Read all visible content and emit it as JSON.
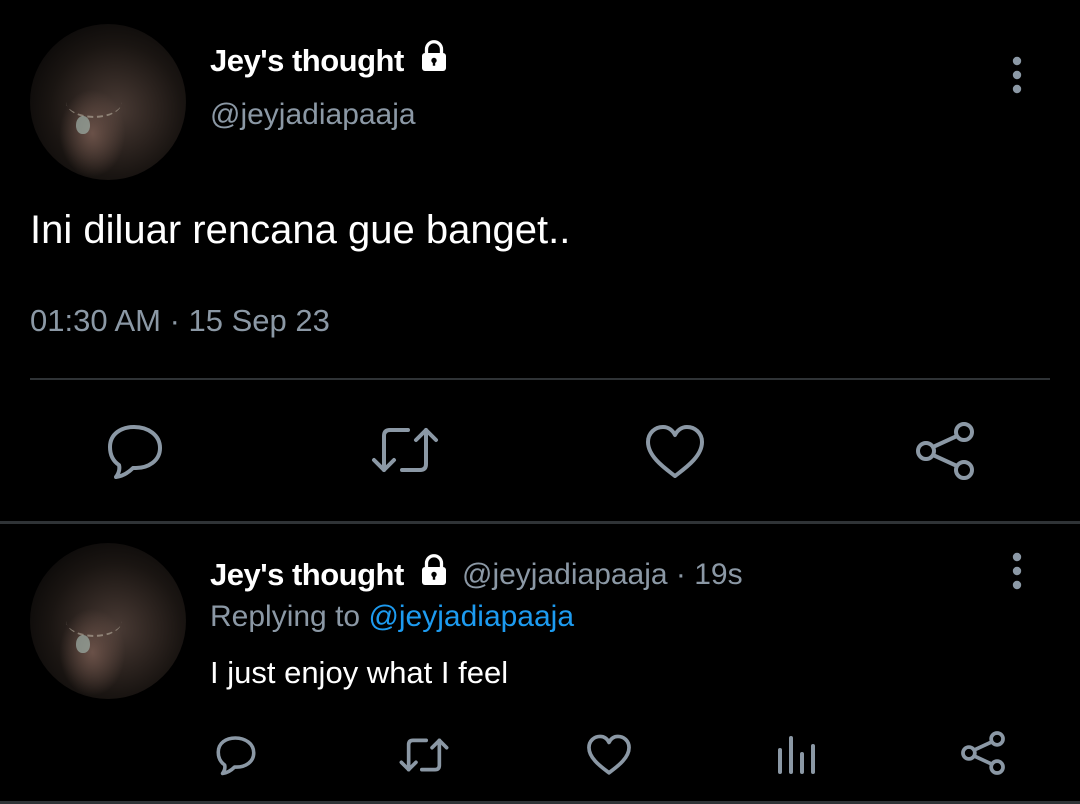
{
  "main_tweet": {
    "author_name": "Jey's thought",
    "handle": "@jeyjadiapaaja",
    "text": "Ini diluar rencana gue banget..",
    "timestamp": "01:30 AM · 15 Sep 23",
    "icons": [
      "lock-icon",
      "more-icon",
      "reply-icon",
      "retweet-icon",
      "like-icon",
      "share-icon"
    ]
  },
  "reply_tweet": {
    "author_name": "Jey's thought",
    "handle_time": "@jeyjadiapaaja · 19s",
    "replying_prefix": "Replying to",
    "replying_handle": "@jeyjadiapaaja",
    "text": "I just enjoy what I feel",
    "icons": [
      "lock-icon",
      "more-icon",
      "reply-icon",
      "retweet-icon",
      "like-icon",
      "analytics-icon",
      "share-icon"
    ]
  },
  "colors": {
    "background": "#000000",
    "text": "#e7e9ea",
    "muted": "#8b98a5",
    "link": "#1d9bf0",
    "divider": "#2f3336"
  }
}
